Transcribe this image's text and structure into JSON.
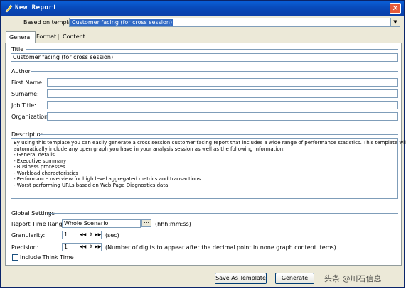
{
  "window": {
    "title": "New Report",
    "close_glyph": "✕",
    "app_icon": "pen-icon"
  },
  "template": {
    "label": "Based on template",
    "value": "Customer facing (for cross session)"
  },
  "tabs": [
    {
      "label": "General",
      "active": true
    },
    {
      "label": "Format",
      "active": false
    },
    {
      "label": "Content",
      "active": false
    }
  ],
  "title_group": {
    "label": "Title",
    "value": "Customer facing (for cross session)"
  },
  "author": {
    "label": "Author",
    "fields": [
      {
        "label": "First Name:",
        "value": ""
      },
      {
        "label": "Surname:",
        "value": ""
      },
      {
        "label": "Job Title:",
        "value": ""
      },
      {
        "label": "Organization:",
        "value": ""
      }
    ]
  },
  "description": {
    "label": "Description",
    "lines": [
      "By using this template you can easily generate a cross session customer facing report that includes a wide range of performance statistics. This template will",
      "automatically include any open graph you have in your analysis session as well as the following information:",
      "- General details",
      "- Executive summary",
      "- Business processes",
      "- Workload characteristics",
      "- Performance overview for high level aggregated metrics and transactions",
      "- Worst performing URLs based on Web Page Diagnostics data"
    ]
  },
  "global_settings": {
    "label": "Global Settings",
    "time_range": {
      "label": "Report Time Range:",
      "value": "Whole Scenario",
      "button": "···",
      "hint": "(hhh:mm:ss)"
    },
    "granularity": {
      "label": "Granularity:",
      "value": "1",
      "unit": "(sec)"
    },
    "precision": {
      "label": "Precision:",
      "value": "1",
      "hint": "(Number of digits to appear after the decimal point in none graph content items)"
    },
    "think_time": {
      "label": "Include Think Time",
      "checked": false
    }
  },
  "buttons": {
    "save_template": "Save As Template",
    "generate": "Generate"
  },
  "watermark": "头条 @川石信息"
}
